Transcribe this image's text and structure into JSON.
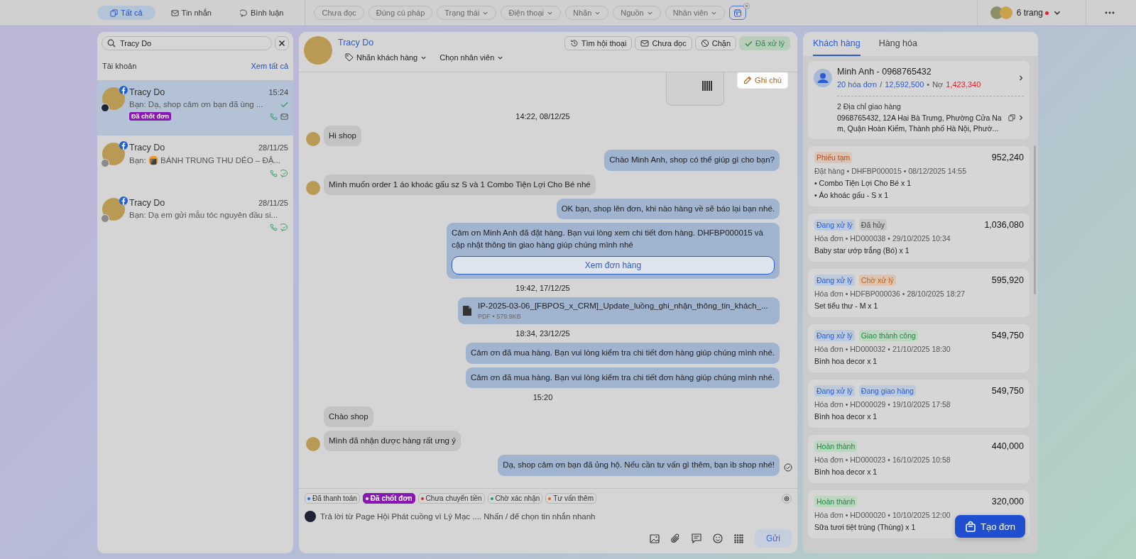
{
  "top_bar": {
    "tabs": [
      {
        "label": "Tất cả",
        "kind": "all",
        "selected": true
      },
      {
        "label": "Tin nhắn",
        "kind": "messages",
        "selected": false
      },
      {
        "label": "Bình luận",
        "kind": "comments",
        "selected": false
      }
    ],
    "filters": [
      {
        "label": "Chưa đọc",
        "dropdown": false
      },
      {
        "label": "Đúng cú pháp",
        "dropdown": false
      },
      {
        "label": "Trạng thái",
        "dropdown": true
      },
      {
        "label": "Điện thoại",
        "dropdown": true
      },
      {
        "label": "Nhãn",
        "dropdown": true
      },
      {
        "label": "Nguồn",
        "dropdown": true
      },
      {
        "label": "Nhân viên",
        "dropdown": true
      }
    ],
    "pages": {
      "label": "6 trang",
      "unread": true
    }
  },
  "conversation_list": {
    "search": {
      "value": "Tracy Do"
    },
    "section_title": "Tài khoản",
    "see_all": "Xem tất cả",
    "items": [
      {
        "name": "Tracy Do",
        "time": "15:24",
        "preview": "Bạn: Dạ, shop cảm ơn bạn đã ùng ...",
        "tag": "Đã chốt đơn",
        "read": true,
        "kind": "inbox",
        "selected": true
      },
      {
        "name": "Tracy Do",
        "time": "28/11/25",
        "preview": "Bạn: 🍘 BÁNH TRUNG THU DẺO – ĐẬ...",
        "read": false,
        "kind": "messenger",
        "selected": false
      },
      {
        "name": "Tracy Do",
        "time": "28/11/25",
        "preview": "Bạn: Dạ em gửi mẫu tóc nguyên đầu si...",
        "read": false,
        "kind": "messenger",
        "selected": false
      }
    ]
  },
  "chat": {
    "contact_name": "Tracy Do",
    "label_button": "Nhãn khách hàng",
    "staff_button": "Chọn nhân viên",
    "actions": [
      {
        "label": "Tìm hội thoại",
        "kind": "history"
      },
      {
        "label": "Chưa đọc",
        "kind": "unread"
      },
      {
        "label": "Chặn",
        "kind": "block"
      },
      {
        "label": "Đã xử lý",
        "kind": "resolved"
      }
    ],
    "note_button": "Ghi chú",
    "messages": [
      {
        "kind": "time",
        "text": "14:22, 08/12/25"
      },
      {
        "kind": "in",
        "text": "Hi shop",
        "avatar": true
      },
      {
        "kind": "out",
        "text": "Chào Minh Anh, shop có thể giúp gì cho bạn?",
        "read": false
      },
      {
        "kind": "in",
        "text": "Mình muốn order 1 áo khoác gấu sz S và 1 Combo Tiện Lợi Cho Bé nhé",
        "avatar": true
      },
      {
        "kind": "out",
        "text": "OK bạn, shop lên đơn, khi nào hàng về sẽ báo lại bạn nhé.",
        "read": false
      },
      {
        "kind": "order",
        "text": "Cảm ơn Minh Anh đã đặt hàng. Bạn vui lòng xem chi tiết đơn hàng. DHFBP000015 và cập nhật thông tin giao hàng giúp chúng mình nhé",
        "button": "Xem đơn hàng"
      },
      {
        "kind": "time",
        "text": "19:42, 17/12/25"
      },
      {
        "kind": "file",
        "text": "IP-2025-03-06_[FBPOS_x_CRM]_Update_luồng_ghi_nhận_thông_tin_khách_...",
        "meta": "PDF • 579.9KB"
      },
      {
        "kind": "time",
        "text": "18:34, 23/12/25"
      },
      {
        "kind": "out",
        "text": "Cảm ơn  đã mua hàng. Bạn vui lòng kiểm tra chi tiết đơn hàng giúp chúng mình nhé.",
        "read": false
      },
      {
        "kind": "out",
        "text": "Cảm ơn  đã mua hàng. Bạn vui lòng kiểm tra chi tiết đơn hàng giúp chúng mình nhé.",
        "read": false
      },
      {
        "kind": "time",
        "text": "15:20"
      },
      {
        "kind": "in",
        "text": "Chào shop",
        "avatar": false
      },
      {
        "kind": "in",
        "text": "Mình đã nhận được hàng rất ưng ý",
        "avatar": true
      },
      {
        "kind": "out",
        "text": "Dạ, shop cảm ơn bạn đã ủng hộ. Nếu cần tư vấn gì thêm, bạn ib shop nhé!",
        "read": true
      }
    ],
    "quick_tags": [
      {
        "label": "Đã thanh toán",
        "color": "#1f66e0",
        "selected": false
      },
      {
        "label": "Đã chốt đơn",
        "color": "#ffffff",
        "selected": true
      },
      {
        "label": "Chưa chuyển tiền",
        "color": "#e0202a",
        "selected": false
      },
      {
        "label": "Chờ xác nhận",
        "color": "#1a9a5a",
        "selected": false
      },
      {
        "label": "Tư vấn thêm",
        "color": "#e0601a",
        "selected": false
      }
    ],
    "composer": {
      "placeholder": "Trả lời từ Page Hội Phát cuồng vì Lý Mạc .... Nhấn / để chọn tin nhắn nhanh",
      "send": "Gửi"
    }
  },
  "customer_panel": {
    "tabs": [
      {
        "label": "Khách hàng",
        "selected": true
      },
      {
        "label": "Hàng hóa",
        "selected": false
      }
    ],
    "customer": {
      "name": "Minh Anh - 0968765432",
      "invoices": "20 hóa đơn",
      "separator": "/",
      "total": "12,592,500",
      "dot": "•",
      "debt_label": "Nợ",
      "debt": "1,423,340",
      "address_title": "2 Địa chỉ giao hàng",
      "address": "0968765432, 12A Hai Bà Trưng, Phường Cửa Nam, Quận Hoàn Kiếm, Thành phố Hà Nội, Phườ..."
    },
    "orders": [
      {
        "badges": [
          {
            "label": "Phiếu tạm",
            "kind": "draft"
          }
        ],
        "amount": "952,240",
        "meta": "Đặt hàng • DHFBP000015 • 08/12/2025 14:55",
        "items": [
          "• Combo Tiện Lợi Cho Bé x 1",
          "• Áo khoác gấu - S x 1"
        ]
      },
      {
        "badges": [
          {
            "label": "Đang xử lý",
            "kind": "processing"
          },
          {
            "label": "Đã hủy",
            "kind": "cancelled"
          }
        ],
        "amount": "1,036,080",
        "meta": "Hóa đơn • HD000038 • 29/10/2025 10:34",
        "items": [
          "Baby star ướp trắng (Bó) x 1"
        ]
      },
      {
        "badges": [
          {
            "label": "Đang xử lý",
            "kind": "processing"
          },
          {
            "label": "Chờ xử lý",
            "kind": "pending"
          }
        ],
        "amount": "595,920",
        "meta": "Hóa đơn • HDFBP000036 • 28/10/2025 18:27",
        "items": [
          "Set tiểu thư - M x 1"
        ]
      },
      {
        "badges": [
          {
            "label": "Đang xử lý",
            "kind": "processing"
          },
          {
            "label": "Giao thành công",
            "kind": "done"
          }
        ],
        "amount": "549,750",
        "meta": "Hóa đơn • HD000032 • 21/10/2025 18:30",
        "items": [
          "Bình hoa decor x 1"
        ]
      },
      {
        "badges": [
          {
            "label": "Đang xử lý",
            "kind": "processing"
          },
          {
            "label": "Đang giao hàng",
            "kind": "processing"
          }
        ],
        "amount": "549,750",
        "meta": "Hóa đơn • HD000029 • 19/10/2025 17:58",
        "items": [
          "Bình hoa decor x 1"
        ]
      },
      {
        "badges": [
          {
            "label": "Hoàn thành",
            "kind": "done"
          }
        ],
        "amount": "440,000",
        "meta": "Hóa đơn • HD000023 • 16/10/2025 10:58",
        "items": [
          "Bình hoa decor x 1"
        ]
      },
      {
        "badges": [
          {
            "label": "Hoàn thành",
            "kind": "done"
          }
        ],
        "amount": "320,000",
        "meta": "Hóa đơn • HD000020 • 10/10/2025 12:00",
        "items": [
          "Sữa tươi tiệt trùng (Thùng) x 1"
        ]
      }
    ],
    "create_button": "Tạo đơn"
  }
}
